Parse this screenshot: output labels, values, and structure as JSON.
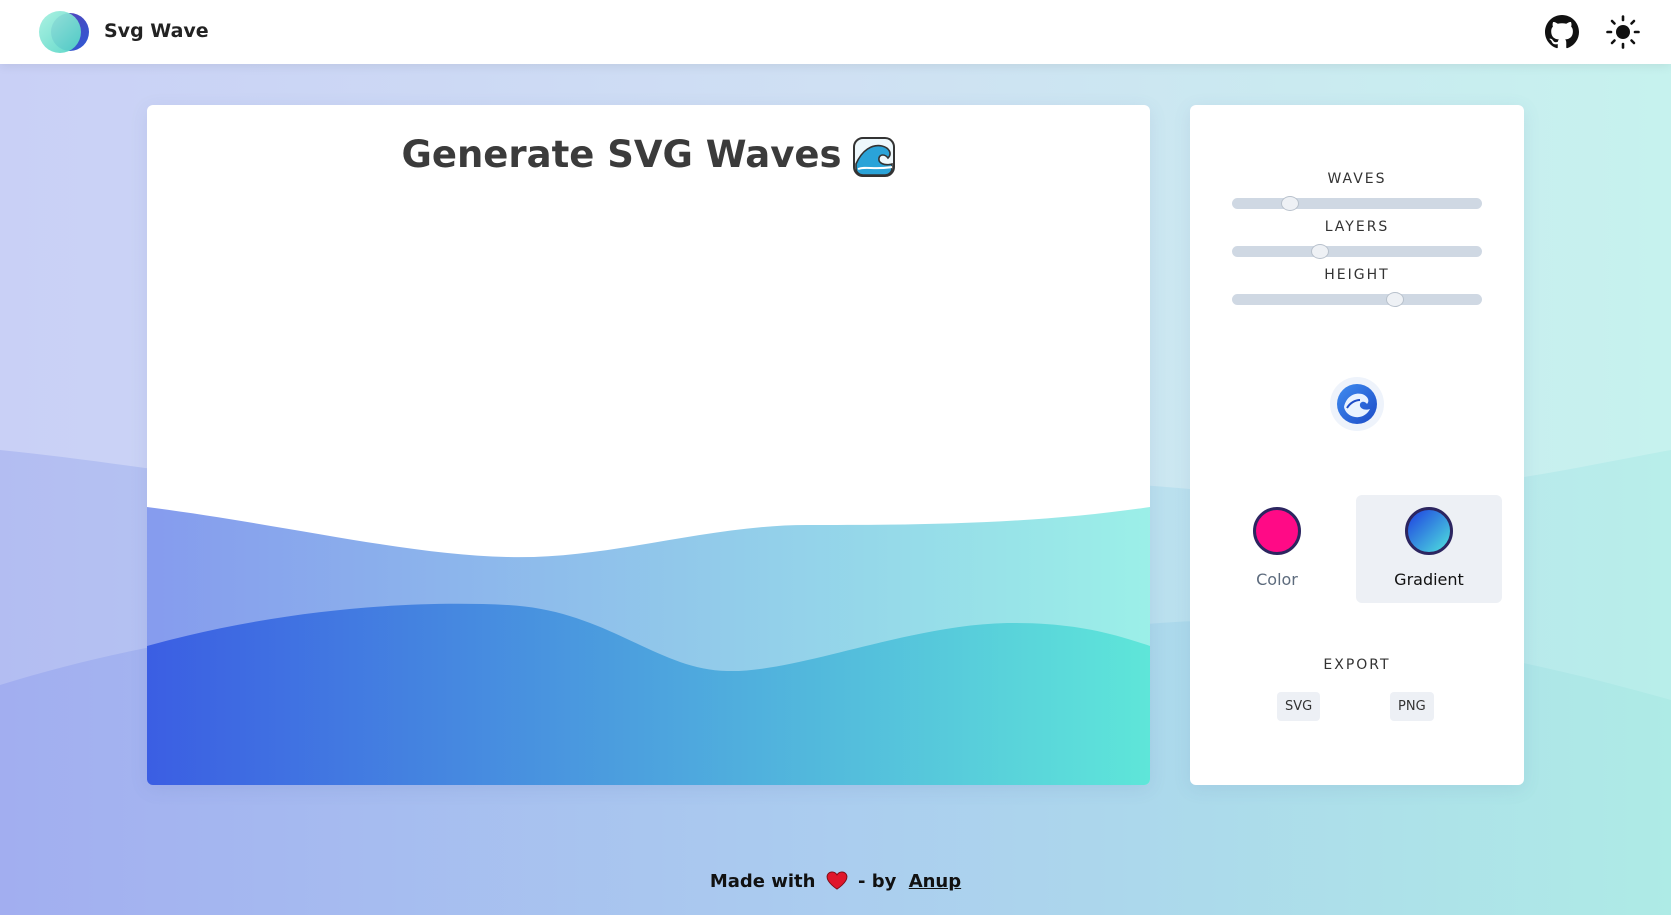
{
  "app": {
    "brand": "Svg Wave"
  },
  "header": {
    "github_icon": "github-icon",
    "theme_icon": "sun-icon"
  },
  "main": {
    "title": "Generate SVG Waves",
    "title_icon": "wave-emoji-icon"
  },
  "controls": {
    "sliders": [
      {
        "label": "WAVES",
        "value": 0.23
      },
      {
        "label": "LAYERS",
        "value": 0.35
      },
      {
        "label": "HEIGHT",
        "value": 0.65
      }
    ],
    "randomize_icon": "wave-randomize-icon",
    "modes": [
      {
        "label": "Color",
        "selected": false,
        "color": "#ff0a86"
      },
      {
        "label": "Gradient",
        "selected": true,
        "gradient": [
          "#1e3fe0",
          "#4fe3de"
        ]
      }
    ],
    "export": {
      "label": "EXPORT",
      "svg": "SVG",
      "png": "PNG"
    }
  },
  "footer": {
    "text_before": "Made with",
    "heart_icon": "heart-icon",
    "text_by": "- by",
    "author": "Anup"
  },
  "colors": {
    "gradient_start": "#3b5ee3",
    "gradient_end": "#5ee6d9",
    "page_left": "#c9d0f6",
    "page_right": "#c6f2ee",
    "mode_inactive_text": "#5d6b7d",
    "mode_active_text": "#111111"
  }
}
